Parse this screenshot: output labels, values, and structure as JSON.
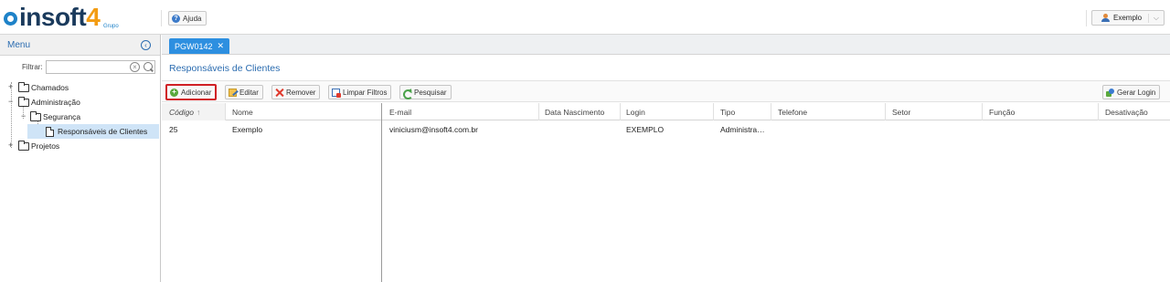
{
  "app": {
    "logo_text": "insoft",
    "logo_number": "4",
    "logo_sub": "Grupo",
    "help_label": "Ajuda",
    "user_label": "Exemplo"
  },
  "sidebar": {
    "title": "Menu",
    "filter_label": "Filtrar:",
    "filter_value": "",
    "items": [
      {
        "label": "Chamados",
        "level": 0,
        "type": "folder",
        "expander": "+"
      },
      {
        "label": "Administração",
        "level": 0,
        "type": "folder-open",
        "expander": "−"
      },
      {
        "label": "Segurança",
        "level": 1,
        "type": "folder-open",
        "expander": "−"
      },
      {
        "label": "Responsáveis de Clientes",
        "level": 2,
        "type": "document",
        "selected": true
      },
      {
        "label": "Projetos",
        "level": 0,
        "type": "folder",
        "expander": "+"
      }
    ]
  },
  "tabs": [
    {
      "label": "PGW0142",
      "close": "✕",
      "active": true
    }
  ],
  "page": {
    "title": "Responsáveis de Clientes"
  },
  "toolbar": {
    "add_label": "Adicionar",
    "edit_label": "Editar",
    "remove_label": "Remover",
    "clear_filters_label": "Limpar Filtros",
    "search_label": "Pesquisar",
    "generate_login_label": "Gerar Login"
  },
  "grid": {
    "columns": [
      "Código",
      "Nome",
      "E-mail",
      "Data Nascimento",
      "Login",
      "Tipo",
      "Telefone",
      "Setor",
      "Função",
      "Desativação"
    ],
    "sort_indicator": "↑",
    "rows": [
      [
        "25",
        "Exemplo",
        "viniciusm@insoft4.com.br",
        "",
        "EXEMPLO",
        "Administra…",
        "",
        "",
        "",
        ""
      ]
    ]
  },
  "colors": {
    "accent": "#2d8fe0",
    "title_blue": "#2b6cb0",
    "highlight_border": "#d01f25",
    "selected_row": "#cfe4f7"
  }
}
